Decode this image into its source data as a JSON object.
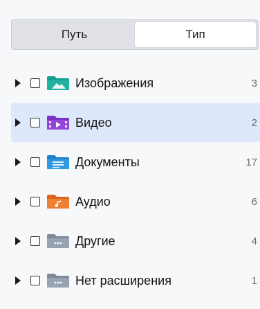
{
  "segmented": {
    "options": [
      "Путь",
      "Тип"
    ],
    "active_index": 1
  },
  "categories": [
    {
      "label": "Изображения",
      "count": "3",
      "icon": "image-folder-icon",
      "color": "#1a9e8f",
      "selected": false
    },
    {
      "label": "Видео",
      "count": "2",
      "icon": "video-folder-icon",
      "color": "#8c3fd1",
      "selected": true
    },
    {
      "label": "Документы",
      "count": "17",
      "icon": "document-folder-icon",
      "color": "#2a8fd6",
      "selected": false
    },
    {
      "label": "Аудио",
      "count": "6",
      "icon": "audio-folder-icon",
      "color": "#e5732c",
      "selected": false
    },
    {
      "label": "Другие",
      "count": "4",
      "icon": "other-folder-icon",
      "color": "#8a97a6",
      "selected": false
    },
    {
      "label": "Нет расширения",
      "count": "1",
      "icon": "no-extension-folder-icon",
      "color": "#8a97a6",
      "selected": false
    }
  ]
}
